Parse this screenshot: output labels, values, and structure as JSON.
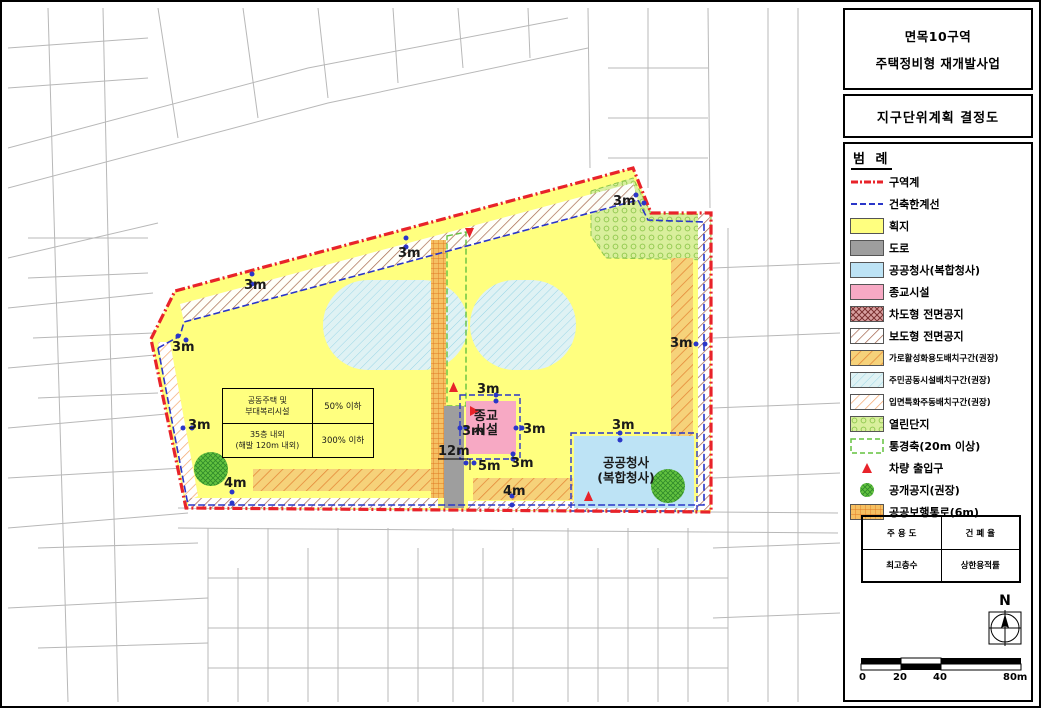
{
  "title": {
    "line1": "면목10구역",
    "line2": "주택정비형 재개발사업"
  },
  "subtitle": "지구단위계획 결정도",
  "legend": {
    "heading": "범 례",
    "items": [
      {
        "label": "구역계",
        "icon": "district-boundary-line",
        "color": "#e8232a"
      },
      {
        "label": "건축한계선",
        "icon": "building-limit-line",
        "color": "#2a36c8"
      },
      {
        "label": "획지",
        "icon": "lot-fill",
        "color": "#ffff7f"
      },
      {
        "label": "도로",
        "icon": "road-fill",
        "color": "#9e9e9e"
      },
      {
        "label": "공공청사(복합청사)",
        "icon": "public-office-fill",
        "color": "#bde3f5"
      },
      {
        "label": "종교시설",
        "icon": "religious-facility-fill",
        "color": "#f7a9c4"
      },
      {
        "label": "차도형 전면공지",
        "icon": "roadway-frontage-hatch",
        "color": "#8b3a3a"
      },
      {
        "label": "보도형 전면공지",
        "icon": "sidewalk-frontage-hatch",
        "color": "#b06a4f"
      },
      {
        "label": "가로활성화용도배치구간(권장)",
        "icon": "street-activation-hatch",
        "color": "#f28c3a"
      },
      {
        "label": "주민공동시설배치구간(권장)",
        "icon": "community-facility-hatch",
        "color": "#9ad6e6"
      },
      {
        "label": "입면특화주동배치구간(권장)",
        "icon": "facade-special-hatch",
        "color": "#f4a56a"
      },
      {
        "label": "열린단지",
        "icon": "open-complex-dots",
        "color": "#93d15a"
      },
      {
        "label": "통경축(20m 이상)",
        "icon": "view-corridor-dash",
        "color": "#63c23f"
      },
      {
        "label": "차량 출입구",
        "icon": "vehicle-entrance-triangle",
        "color": "#e8232a"
      },
      {
        "label": "공개공지(권장)",
        "icon": "public-open-space-circle",
        "color": "#3fbf3f"
      },
      {
        "label": "공공보행통로(6m)",
        "icon": "public-walkway-grid",
        "color": "#f07a2a"
      }
    ],
    "table": {
      "r1c1": "주 용 도",
      "r1c2": "건 폐 율",
      "r2c1": "최고층수",
      "r2c2": "상한용적률"
    },
    "north": "N",
    "scale": [
      "0",
      "20",
      "40",
      "80m"
    ]
  },
  "map": {
    "setbacks": {
      "a": "3m",
      "b": "3m",
      "c": "3m",
      "d": "3m",
      "e": "3m",
      "f": "3m",
      "g": "3m",
      "h": "3m",
      "i": "3m",
      "j": "4m",
      "k": "4m",
      "l": "3m",
      "m": "3m",
      "n": "3m"
    },
    "road_width": "12m",
    "road_setback": "5m",
    "religious_label": [
      "종교",
      "시설"
    ],
    "public_office_label": [
      "공공청사",
      "(복합청사)"
    ],
    "table": {
      "r1c1a": "공동주택 및",
      "r1c1b": "부대복리시설",
      "r1c2": "50% 이하",
      "r2c1a": "35층 내외",
      "r2c1b": "(해발 120m 내외)",
      "r2c2": "300% 이하"
    }
  }
}
